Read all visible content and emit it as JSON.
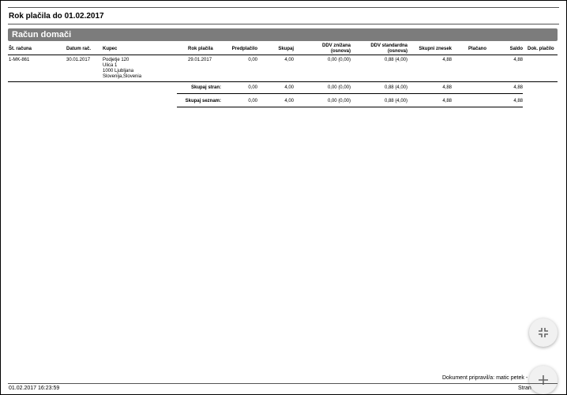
{
  "report": {
    "title": "Rok plačila do 01.02.2017",
    "section_title": "Račun domači"
  },
  "table": {
    "headers": {
      "invoice_no": "Št. računa",
      "invoice_date": "Datum rač.",
      "customer": "Kupec",
      "due_date": "Rok plačila",
      "prepayment": "Predplačilo",
      "total": "Skupaj",
      "vat_reduced_1": "DDV znižana",
      "vat_reduced_2": "(osnova)",
      "vat_standard_1": "DDV standardna",
      "vat_standard_2": "(osnova)",
      "total_amount": "Skupni znesek",
      "paid": "Plačano",
      "balance": "Saldo",
      "doc_paid": "Dok. plačilo"
    },
    "rows": [
      {
        "invoice_no": "1-MK-861",
        "invoice_date": "30.01.2017",
        "customer_line1": "Podjetje 120",
        "customer_line2": "Ulica 1",
        "customer_line3": "1000 Ljubljana",
        "customer_line4": "Slovenija,Slovenia",
        "due_date": "29.01.2017",
        "prepayment": "0,00",
        "total": "4,00",
        "vat_reduced": "0,00 (0,00)",
        "vat_standard": "0,88 (4,00)",
        "total_amount": "4,88",
        "paid": "",
        "balance": "4,88"
      }
    ],
    "totals": [
      {
        "label": "Skupaj stran:",
        "prepayment": "0,00",
        "total": "4,00",
        "vat_reduced": "0,00 (0,00)",
        "vat_standard": "0,88 (4,00)",
        "total_amount": "4,88",
        "balance": "4,88"
      },
      {
        "label": "Skupaj seznam:",
        "prepayment": "0,00",
        "total": "4,00",
        "vat_reduced": "0,00 (0,00)",
        "vat_standard": "0,88 (4,00)",
        "total_amount": "4,88",
        "balance": "4,88"
      }
    ]
  },
  "footer": {
    "prepared_by": "Dokument pripravil/a: matic petek -",
    "timestamp": "01.02.2017 16:23:59",
    "page_label": "Stran"
  },
  "fabs": {
    "collapse_icon": "collapse-icon",
    "add_icon": "plus-icon"
  }
}
